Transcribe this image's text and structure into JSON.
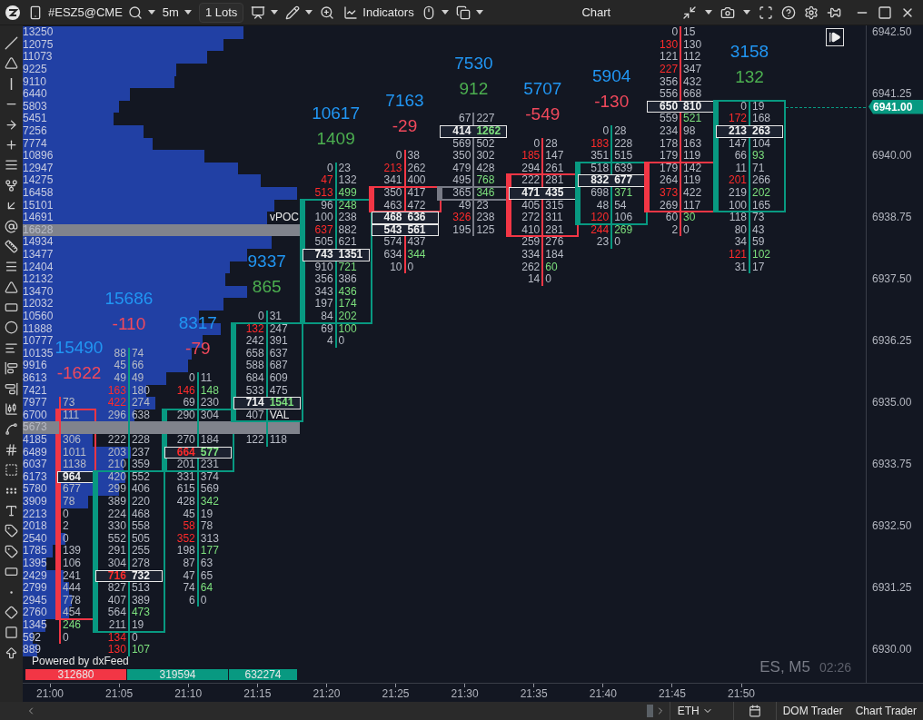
{
  "toolbar": {
    "symbol": "#ESZ5@CME",
    "timeframe": "5m",
    "lots": "1 Lots",
    "indicators": "Indicators",
    "title": "Chart"
  },
  "profile": [
    {
      "volume": "13250",
      "highlight": false
    },
    {
      "volume": "12075",
      "highlight": false
    },
    {
      "volume": "11073",
      "highlight": false
    },
    {
      "volume": "9225",
      "highlight": false
    },
    {
      "volume": "9110",
      "highlight": false
    },
    {
      "volume": "6440",
      "highlight": false
    },
    {
      "volume": "5803",
      "highlight": false
    },
    {
      "volume": "5451",
      "highlight": false
    },
    {
      "volume": "7256",
      "highlight": false
    },
    {
      "volume": "7774",
      "highlight": false
    },
    {
      "volume": "10896",
      "highlight": false
    },
    {
      "volume": "12947",
      "highlight": false
    },
    {
      "volume": "14275",
      "highlight": false
    },
    {
      "volume": "16458",
      "highlight": false
    },
    {
      "volume": "15101",
      "highlight": false
    },
    {
      "volume": "14691",
      "highlight": false
    },
    {
      "volume": "16628",
      "highlight": true
    },
    {
      "volume": "14934",
      "highlight": false
    },
    {
      "volume": "13477",
      "highlight": false
    },
    {
      "volume": "12404",
      "highlight": false
    },
    {
      "volume": "12132",
      "highlight": false
    },
    {
      "volume": "13470",
      "highlight": false
    },
    {
      "volume": "12032",
      "highlight": false
    },
    {
      "volume": "10560",
      "highlight": false
    },
    {
      "volume": "11888",
      "highlight": false
    },
    {
      "volume": "10777",
      "highlight": false
    },
    {
      "volume": "10135",
      "highlight": false
    },
    {
      "volume": "9916",
      "highlight": false
    },
    {
      "volume": "8613",
      "highlight": false
    },
    {
      "volume": "7421",
      "highlight": false
    },
    {
      "volume": "7977",
      "highlight": false
    },
    {
      "volume": "6700",
      "highlight": false
    },
    {
      "volume": "5673",
      "highlight": true
    },
    {
      "volume": "4185",
      "highlight": false
    },
    {
      "volume": "6489",
      "highlight": false
    },
    {
      "volume": "6037",
      "highlight": false
    },
    {
      "volume": "6173",
      "highlight": false
    },
    {
      "volume": "5780",
      "highlight": false
    },
    {
      "volume": "3909",
      "highlight": false
    },
    {
      "volume": "2213",
      "highlight": false
    },
    {
      "volume": "2018",
      "highlight": false
    },
    {
      "volume": "2540",
      "highlight": false
    },
    {
      "volume": "1785",
      "highlight": false
    },
    {
      "volume": "1395",
      "highlight": false
    },
    {
      "volume": "2429",
      "highlight": false
    },
    {
      "volume": "2799",
      "highlight": false
    },
    {
      "volume": "2945",
      "highlight": false
    },
    {
      "volume": "2760",
      "highlight": false
    },
    {
      "volume": "1345",
      "highlight": false
    },
    {
      "volume": "592",
      "highlight": false
    },
    {
      "volume": "889",
      "highlight": false
    }
  ],
  "vpoc_label": "vPOC",
  "candles": [
    {
      "volume": "15490",
      "delta": "-1622",
      "delta_negative": true,
      "kind": "down",
      "rows": [
        null,
        null,
        null,
        null,
        null,
        null,
        null,
        null,
        null,
        null,
        null,
        null,
        null,
        null,
        null,
        null,
        null,
        null,
        null,
        null,
        null,
        null,
        null,
        null,
        null,
        null,
        null,
        null,
        null,
        null,
        {
          "ask": "73",
          "ask_green": false,
          "body": false,
          "poc": false
        },
        {
          "ask": "111",
          "ask_green": false,
          "body": true,
          "poc": false
        },
        null,
        {
          "ask": "306",
          "ask_green": false,
          "body": true,
          "poc": false
        },
        {
          "ask": "1011",
          "ask_green": false,
          "body": true,
          "poc": false
        },
        {
          "ask": "1138",
          "ask_green": false,
          "body": true,
          "poc": false
        },
        {
          "ask": "964",
          "ask_green": false,
          "body": true,
          "poc": true
        },
        {
          "ask": "677",
          "ask_green": false,
          "body": true,
          "poc": false
        },
        {
          "ask": "78",
          "ask_green": false,
          "body": true,
          "poc": false
        },
        {
          "ask": "0",
          "ask_green": false,
          "body": true,
          "poc": false
        },
        {
          "ask": "2",
          "ask_green": false,
          "body": true,
          "poc": false
        },
        {
          "ask": "0",
          "ask_green": false,
          "body": true,
          "poc": false
        },
        {
          "ask": "139",
          "ask_green": false,
          "body": true,
          "poc": false
        },
        {
          "ask": "106",
          "ask_green": false,
          "body": true,
          "poc": false
        },
        {
          "ask": "241",
          "ask_green": false,
          "body": true,
          "poc": false
        },
        {
          "ask": "444",
          "ask_green": false,
          "body": true,
          "poc": false
        },
        {
          "ask": "778",
          "ask_green": false,
          "body": true,
          "poc": false
        },
        {
          "ask": "454",
          "ask_green": false,
          "body": true,
          "poc": false
        },
        {
          "ask": "246",
          "ask_green": true,
          "body": false,
          "poc": false
        },
        {
          "ask": "0",
          "ask_green": false,
          "body": false,
          "poc": false
        }
      ]
    },
    {
      "volume": "15686",
      "delta": "-110",
      "delta_negative": true,
      "kind": "up",
      "rows": [
        null,
        null,
        null,
        null,
        null,
        null,
        null,
        null,
        null,
        null,
        null,
        null,
        null,
        null,
        null,
        null,
        null,
        null,
        null,
        null,
        null,
        null,
        null,
        null,
        null,
        null,
        {
          "bid": "88",
          "ask": "74",
          "bid_red": false,
          "ask_green": false,
          "body": false,
          "poc": false
        },
        {
          "bid": "45",
          "ask": "66",
          "bid_red": false,
          "ask_green": false,
          "body": false,
          "poc": false
        },
        {
          "bid": "49",
          "ask": "49",
          "bid_red": false,
          "ask_green": false,
          "body": false,
          "poc": false
        },
        {
          "bid": "163",
          "ask": "180",
          "bid_red": true,
          "ask_green": false,
          "body": false,
          "poc": false
        },
        {
          "bid": "422",
          "ask": "274",
          "bid_red": true,
          "ask_green": false,
          "body": false,
          "poc": false
        },
        {
          "bid": "296",
          "ask": "638",
          "bid_red": false,
          "ask_green": false,
          "body": false,
          "poc": false
        },
        null,
        {
          "bid": "222",
          "ask": "228",
          "bid_red": false,
          "ask_green": false,
          "body": false,
          "poc": false
        },
        {
          "bid": "203",
          "ask": "237",
          "bid_red": false,
          "ask_green": false,
          "body": false,
          "poc": false
        },
        {
          "bid": "210",
          "ask": "359",
          "bid_red": false,
          "ask_green": false,
          "body": false,
          "poc": false
        },
        {
          "bid": "420",
          "ask": "552",
          "bid_red": false,
          "ask_green": false,
          "body": true,
          "poc": false
        },
        {
          "bid": "299",
          "ask": "406",
          "bid_red": false,
          "ask_green": false,
          "body": true,
          "poc": false
        },
        {
          "bid": "389",
          "ask": "220",
          "bid_red": false,
          "ask_green": false,
          "body": true,
          "poc": false
        },
        {
          "bid": "224",
          "ask": "468",
          "bid_red": false,
          "ask_green": false,
          "body": true,
          "poc": false
        },
        {
          "bid": "330",
          "ask": "558",
          "bid_red": false,
          "ask_green": false,
          "body": true,
          "poc": false
        },
        {
          "bid": "552",
          "ask": "505",
          "bid_red": false,
          "ask_green": false,
          "body": true,
          "poc": false
        },
        {
          "bid": "291",
          "ask": "255",
          "bid_red": false,
          "ask_green": false,
          "body": true,
          "poc": false
        },
        {
          "bid": "304",
          "ask": "278",
          "bid_red": false,
          "ask_green": false,
          "body": true,
          "poc": false
        },
        {
          "bid": "716",
          "ask": "732",
          "bid_red": true,
          "ask_green": false,
          "body": true,
          "poc": true
        },
        {
          "bid": "827",
          "ask": "513",
          "bid_red": false,
          "ask_green": false,
          "body": true,
          "poc": false
        },
        {
          "bid": "407",
          "ask": "389",
          "bid_red": false,
          "ask_green": false,
          "body": true,
          "poc": false
        },
        {
          "bid": "564",
          "ask": "473",
          "bid_red": false,
          "ask_green": true,
          "body": true,
          "poc": false
        },
        {
          "bid": "211",
          "ask": "19",
          "bid_red": false,
          "ask_green": false,
          "body": true,
          "poc": false
        },
        {
          "bid": "134",
          "ask": "0",
          "bid_red": true,
          "ask_green": false,
          "body": false,
          "poc": false
        },
        {
          "bid": "130",
          "ask": "107",
          "bid_red": true,
          "ask_green": true,
          "body": false,
          "poc": false
        }
      ]
    },
    {
      "volume": "8317",
      "delta": "-79",
      "delta_negative": true,
      "kind": "up",
      "rows": [
        null,
        null,
        null,
        null,
        null,
        null,
        null,
        null,
        null,
        null,
        null,
        null,
        null,
        null,
        null,
        null,
        null,
        null,
        null,
        null,
        null,
        null,
        null,
        null,
        null,
        null,
        null,
        null,
        {
          "bid": "0",
          "ask": "11",
          "bid_red": false,
          "ask_green": false,
          "body": false,
          "poc": false
        },
        {
          "bid": "146",
          "ask": "148",
          "bid_red": true,
          "ask_green": true,
          "body": false,
          "poc": false
        },
        {
          "bid": "69",
          "ask": "230",
          "bid_red": false,
          "ask_green": false,
          "body": false,
          "poc": false
        },
        {
          "bid": "290",
          "ask": "304",
          "bid_red": false,
          "ask_green": false,
          "body": true,
          "poc": false
        },
        null,
        {
          "bid": "270",
          "ask": "184",
          "bid_red": false,
          "ask_green": false,
          "body": true,
          "poc": false
        },
        {
          "bid": "664",
          "ask": "577",
          "bid_red": true,
          "ask_green": true,
          "body": true,
          "poc": true
        },
        {
          "bid": "201",
          "ask": "231",
          "bid_red": false,
          "ask_green": false,
          "body": true,
          "poc": false
        },
        {
          "bid": "331",
          "ask": "374",
          "bid_red": false,
          "ask_green": false,
          "body": false,
          "poc": false
        },
        {
          "bid": "615",
          "ask": "569",
          "bid_red": false,
          "ask_green": false,
          "body": false,
          "poc": false
        },
        {
          "bid": "428",
          "ask": "342",
          "bid_red": false,
          "ask_green": true,
          "body": false,
          "poc": false
        },
        {
          "bid": "45",
          "ask": "19",
          "bid_red": false,
          "ask_green": false,
          "body": false,
          "poc": false
        },
        {
          "bid": "58",
          "ask": "78",
          "bid_red": true,
          "ask_green": false,
          "body": false,
          "poc": false
        },
        {
          "bid": "352",
          "ask": "313",
          "bid_red": true,
          "ask_green": false,
          "body": false,
          "poc": false
        },
        {
          "bid": "198",
          "ask": "177",
          "bid_red": false,
          "ask_green": true,
          "body": false,
          "poc": false
        },
        {
          "bid": "87",
          "ask": "63",
          "bid_red": false,
          "ask_green": false,
          "body": false,
          "poc": false
        },
        {
          "bid": "47",
          "ask": "65",
          "bid_red": false,
          "ask_green": false,
          "body": false,
          "poc": false
        },
        {
          "bid": "74",
          "ask": "64",
          "bid_red": false,
          "ask_green": true,
          "body": false,
          "poc": false
        },
        {
          "bid": "6",
          "ask": "0",
          "bid_red": false,
          "ask_green": false,
          "body": false,
          "poc": false
        }
      ]
    },
    {
      "volume": "9337",
      "delta": "865",
      "delta_negative": false,
      "kind": "up",
      "rows": [
        null,
        null,
        null,
        null,
        null,
        null,
        null,
        null,
        null,
        null,
        null,
        null,
        null,
        null,
        null,
        null,
        null,
        null,
        null,
        null,
        null,
        null,
        null,
        {
          "bid": "0",
          "ask": "31",
          "bid_red": false,
          "ask_green": false,
          "body": false,
          "poc": false
        },
        {
          "bid": "132",
          "ask": "247",
          "bid_red": true,
          "ask_green": false,
          "body": true,
          "poc": false
        },
        {
          "bid": "242",
          "ask": "391",
          "bid_red": false,
          "ask_green": false,
          "body": true,
          "poc": false
        },
        {
          "bid": "658",
          "ask": "637",
          "bid_red": false,
          "ask_green": false,
          "body": true,
          "poc": false
        },
        {
          "bid": "588",
          "ask": "687",
          "bid_red": false,
          "ask_green": false,
          "body": true,
          "poc": false
        },
        {
          "bid": "684",
          "ask": "609",
          "bid_red": false,
          "ask_green": false,
          "body": true,
          "poc": false
        },
        {
          "bid": "533",
          "ask": "475",
          "bid_red": false,
          "ask_green": false,
          "body": true,
          "poc": false
        },
        {
          "bid": "714",
          "ask": "1541",
          "bid_red": false,
          "ask_green": true,
          "body": true,
          "poc": true
        },
        {
          "bid": "407",
          "bid_red": false,
          "label": "VAL",
          "body": true,
          "poc": false
        },
        null,
        {
          "bid": "122",
          "ask": "118",
          "bid_red": false,
          "ask_green": false,
          "body": false,
          "poc": false
        }
      ]
    },
    {
      "volume": "10617",
      "delta": "1409",
      "delta_negative": false,
      "kind": "up",
      "rows": [
        null,
        null,
        null,
        null,
        null,
        null,
        null,
        null,
        null,
        null,
        null,
        {
          "bid": "0",
          "ask": "23",
          "bid_red": false,
          "ask_green": false,
          "body": false,
          "poc": false
        },
        {
          "bid": "47",
          "ask": "132",
          "bid_red": true,
          "ask_green": false,
          "body": false,
          "poc": false
        },
        {
          "bid": "513",
          "ask": "499",
          "bid_red": true,
          "ask_green": true,
          "body": false,
          "poc": false
        },
        {
          "bid": "96",
          "ask": "248",
          "bid_red": false,
          "ask_green": true,
          "body": true,
          "poc": false
        },
        {
          "bid": "100",
          "ask": "238",
          "bid_red": false,
          "ask_green": false,
          "body": true,
          "poc": false
        },
        {
          "bid": "637",
          "ask": "882",
          "bid_red": true,
          "ask_green": false,
          "body": true,
          "poc": false
        },
        {
          "bid": "505",
          "ask": "621",
          "bid_red": false,
          "ask_green": false,
          "body": true,
          "poc": false
        },
        {
          "bid": "743",
          "ask": "1351",
          "bid_red": false,
          "ask_green": false,
          "body": true,
          "poc": true
        },
        {
          "bid": "910",
          "ask": "721",
          "bid_red": false,
          "ask_green": true,
          "body": true,
          "poc": false
        },
        {
          "bid": "356",
          "ask": "386",
          "bid_red": false,
          "ask_green": false,
          "body": true,
          "poc": false
        },
        {
          "bid": "343",
          "ask": "436",
          "bid_red": false,
          "ask_green": true,
          "body": true,
          "poc": false
        },
        {
          "bid": "197",
          "ask": "174",
          "bid_red": false,
          "ask_green": true,
          "body": true,
          "poc": false
        },
        {
          "bid": "84",
          "ask": "202",
          "bid_red": false,
          "ask_green": true,
          "body": true,
          "poc": false
        },
        {
          "bid": "69",
          "ask": "100",
          "bid_red": false,
          "ask_green": true,
          "body": false,
          "poc": false
        },
        {
          "bid": "4",
          "ask": "0",
          "bid_red": false,
          "ask_green": false,
          "body": false,
          "poc": false
        }
      ]
    },
    {
      "volume": "7163",
      "delta": "-29",
      "delta_negative": true,
      "kind": "down",
      "rows": [
        null,
        null,
        null,
        null,
        null,
        null,
        null,
        null,
        null,
        null,
        {
          "bid": "0",
          "ask": "38",
          "bid_red": false,
          "ask_green": false,
          "body": false,
          "poc": false
        },
        {
          "bid": "213",
          "ask": "262",
          "bid_red": true,
          "ask_green": false,
          "body": false,
          "poc": false
        },
        {
          "bid": "341",
          "ask": "400",
          "bid_red": false,
          "ask_green": false,
          "body": false,
          "poc": false
        },
        {
          "bid": "350",
          "ask": "417",
          "bid_red": false,
          "ask_green": false,
          "body": true,
          "poc": false
        },
        {
          "bid": "463",
          "ask": "472",
          "bid_red": false,
          "ask_green": false,
          "body": true,
          "poc": false
        },
        {
          "bid": "468",
          "ask": "636",
          "bid_red": false,
          "ask_green": false,
          "body": false,
          "poc": true
        },
        {
          "bid": "543",
          "ask": "561",
          "bid_red": false,
          "ask_green": false,
          "body": false,
          "poc": true
        },
        {
          "bid": "574",
          "ask": "437",
          "bid_red": false,
          "ask_green": false,
          "body": false,
          "poc": false
        },
        {
          "bid": "634",
          "ask": "344",
          "bid_red": false,
          "ask_green": true,
          "body": false,
          "poc": false
        },
        {
          "bid": "10",
          "ask": "0",
          "bid_red": false,
          "ask_green": false,
          "body": false,
          "poc": false
        }
      ]
    },
    {
      "volume": "7530",
      "delta": "912",
      "delta_negative": false,
      "kind": "flat",
      "rows": [
        null,
        null,
        null,
        null,
        null,
        null,
        null,
        {
          "bid": "67",
          "ask": "227",
          "bid_red": false,
          "ask_green": false,
          "body": false,
          "poc": false
        },
        {
          "bid": "414",
          "ask": "1262",
          "bid_red": false,
          "ask_green": true,
          "body": false,
          "poc": true
        },
        {
          "bid": "569",
          "ask": "502",
          "bid_red": false,
          "ask_green": false,
          "body": false,
          "poc": false
        },
        {
          "bid": "350",
          "ask": "302",
          "bid_red": false,
          "ask_green": false,
          "body": false,
          "poc": false
        },
        {
          "bid": "479",
          "ask": "428",
          "bid_red": false,
          "ask_green": false,
          "body": false,
          "poc": false
        },
        {
          "bid": "495",
          "ask": "768",
          "bid_red": false,
          "ask_green": true,
          "body": false,
          "poc": false
        },
        {
          "bid": "365",
          "ask": "346",
          "bid_red": false,
          "ask_green": true,
          "body": true,
          "poc": false
        },
        {
          "bid": "49",
          "ask": "23",
          "bid_red": false,
          "ask_green": false,
          "body": false,
          "poc": false
        },
        {
          "bid": "326",
          "ask": "238",
          "bid_red": true,
          "ask_green": false,
          "body": false,
          "poc": false
        },
        {
          "bid": "195",
          "ask": "125",
          "bid_red": false,
          "ask_green": false,
          "body": false,
          "poc": false
        }
      ]
    },
    {
      "volume": "5707",
      "delta": "-549",
      "delta_negative": true,
      "kind": "down",
      "rows": [
        null,
        null,
        null,
        null,
        null,
        null,
        null,
        null,
        null,
        {
          "bid": "0",
          "ask": "28",
          "bid_red": false,
          "ask_green": false,
          "body": false,
          "poc": false
        },
        {
          "bid": "185",
          "ask": "147",
          "bid_red": true,
          "ask_green": false,
          "body": false,
          "poc": false
        },
        {
          "bid": "294",
          "ask": "261",
          "bid_red": false,
          "ask_green": false,
          "body": false,
          "poc": false
        },
        {
          "bid": "222",
          "ask": "281",
          "bid_red": false,
          "ask_green": false,
          "body": true,
          "poc": false
        },
        {
          "bid": "471",
          "ask": "435",
          "bid_red": false,
          "ask_green": false,
          "body": true,
          "poc": true
        },
        {
          "bid": "405",
          "ask": "315",
          "bid_red": false,
          "ask_green": false,
          "body": true,
          "poc": false
        },
        {
          "bid": "272",
          "ask": "311",
          "bid_red": false,
          "ask_green": false,
          "body": true,
          "poc": false
        },
        {
          "bid": "410",
          "ask": "281",
          "bid_red": false,
          "ask_green": false,
          "body": true,
          "poc": false
        },
        {
          "bid": "259",
          "ask": "276",
          "bid_red": false,
          "ask_green": false,
          "body": false,
          "poc": false
        },
        {
          "bid": "334",
          "ask": "184",
          "bid_red": false,
          "ask_green": false,
          "body": false,
          "poc": false
        },
        {
          "bid": "262",
          "ask": "60",
          "bid_red": false,
          "ask_green": true,
          "body": false,
          "poc": false
        },
        {
          "bid": "14",
          "ask": "0",
          "bid_red": false,
          "ask_green": false,
          "body": false,
          "poc": false
        }
      ]
    },
    {
      "volume": "5904",
      "delta": "-130",
      "delta_negative": true,
      "kind": "up",
      "rows": [
        null,
        null,
        null,
        null,
        null,
        null,
        null,
        null,
        {
          "bid": "0",
          "ask": "28",
          "bid_red": false,
          "ask_green": false,
          "body": false,
          "poc": false
        },
        {
          "bid": "183",
          "ask": "228",
          "bid_red": true,
          "ask_green": false,
          "body": false,
          "poc": false
        },
        {
          "bid": "351",
          "ask": "515",
          "bid_red": false,
          "ask_green": false,
          "body": false,
          "poc": false
        },
        {
          "bid": "518",
          "ask": "639",
          "bid_red": false,
          "ask_green": false,
          "body": true,
          "poc": false
        },
        {
          "bid": "832",
          "ask": "677",
          "bid_red": false,
          "ask_green": false,
          "body": true,
          "poc": true
        },
        {
          "bid": "698",
          "ask": "371",
          "bid_red": false,
          "ask_green": true,
          "body": true,
          "poc": false
        },
        {
          "bid": "48",
          "ask": "54",
          "bid_red": false,
          "ask_green": false,
          "body": true,
          "poc": false
        },
        {
          "bid": "120",
          "ask": "106",
          "bid_red": true,
          "ask_green": false,
          "body": true,
          "poc": false
        },
        {
          "bid": "244",
          "ask": "269",
          "bid_red": true,
          "ask_green": true,
          "body": false,
          "poc": false
        },
        {
          "bid": "23",
          "ask": "0",
          "bid_red": false,
          "ask_green": false,
          "body": false,
          "poc": false
        }
      ]
    },
    {
      "kind": "down",
      "rows": [
        {
          "bid": "0",
          "ask": "15",
          "bid_red": false,
          "ask_green": false,
          "body": false,
          "poc": false
        },
        {
          "bid": "130",
          "ask": "130",
          "bid_red": true,
          "ask_green": false,
          "body": false,
          "poc": false
        },
        {
          "bid": "121",
          "ask": "112",
          "bid_red": false,
          "ask_green": false,
          "body": false,
          "poc": false
        },
        {
          "bid": "227",
          "ask": "347",
          "bid_red": true,
          "ask_green": false,
          "body": false,
          "poc": false
        },
        {
          "bid": "356",
          "ask": "432",
          "bid_red": false,
          "ask_green": false,
          "body": false,
          "poc": false
        },
        {
          "bid": "556",
          "ask": "668",
          "bid_red": false,
          "ask_green": false,
          "body": false,
          "poc": false
        },
        {
          "bid": "650",
          "ask": "810",
          "bid_red": false,
          "ask_green": false,
          "body": false,
          "poc": true
        },
        {
          "bid": "559",
          "ask": "521",
          "bid_red": false,
          "ask_green": true,
          "body": false,
          "poc": false
        },
        {
          "bid": "234",
          "ask": "98",
          "bid_red": false,
          "ask_green": false,
          "body": false,
          "poc": false
        },
        {
          "bid": "178",
          "ask": "163",
          "bid_red": false,
          "ask_green": false,
          "body": false,
          "poc": false
        },
        {
          "bid": "179",
          "ask": "119",
          "bid_red": false,
          "ask_green": false,
          "body": false,
          "poc": false
        },
        {
          "bid": "179",
          "ask": "142",
          "bid_red": false,
          "ask_green": false,
          "body": true,
          "poc": false
        },
        {
          "bid": "264",
          "ask": "119",
          "bid_red": false,
          "ask_green": false,
          "body": true,
          "poc": false
        },
        {
          "bid": "373",
          "ask": "422",
          "bid_red": true,
          "ask_green": false,
          "body": true,
          "poc": false
        },
        {
          "bid": "269",
          "ask": "117",
          "bid_red": false,
          "ask_green": false,
          "body": true,
          "poc": false
        },
        {
          "bid": "60",
          "ask": "30",
          "bid_red": false,
          "ask_green": true,
          "body": false,
          "poc": false
        },
        {
          "bid": "2",
          "ask": "0",
          "bid_red": false,
          "ask_green": false,
          "body": false,
          "poc": false
        }
      ]
    },
    {
      "volume": "3158",
      "delta": "132",
      "delta_negative": false,
      "kind": "up",
      "rows": [
        null,
        null,
        null,
        null,
        null,
        null,
        {
          "bid": "0",
          "ask": "19",
          "bid_red": false,
          "ask_green": false,
          "body": true,
          "poc": false
        },
        {
          "bid": "172",
          "ask": "168",
          "bid_red": true,
          "ask_green": false,
          "body": true,
          "poc": false
        },
        {
          "bid": "213",
          "ask": "263",
          "bid_red": false,
          "ask_green": false,
          "body": true,
          "poc": true
        },
        {
          "bid": "147",
          "ask": "104",
          "bid_red": false,
          "ask_green": false,
          "body": true,
          "poc": false
        },
        {
          "bid": "66",
          "ask": "93",
          "bid_red": false,
          "ask_green": true,
          "body": true,
          "poc": false
        },
        {
          "bid": "11",
          "ask": "71",
          "bid_red": false,
          "ask_green": false,
          "body": true,
          "poc": false
        },
        {
          "bid": "201",
          "ask": "266",
          "bid_red": true,
          "ask_green": false,
          "body": true,
          "poc": false
        },
        {
          "bid": "219",
          "ask": "202",
          "bid_red": false,
          "ask_green": true,
          "body": true,
          "poc": false
        },
        {
          "bid": "100",
          "ask": "165",
          "bid_red": false,
          "ask_green": false,
          "body": true,
          "poc": false
        },
        {
          "bid": "118",
          "ask": "73",
          "bid_red": false,
          "ask_green": false,
          "body": false,
          "poc": false
        },
        {
          "bid": "80",
          "ask": "43",
          "bid_red": false,
          "ask_green": false,
          "body": false,
          "poc": false
        },
        {
          "bid": "34",
          "ask": "59",
          "bid_red": false,
          "ask_green": false,
          "body": false,
          "poc": false
        },
        {
          "bid": "121",
          "ask": "102",
          "bid_red": true,
          "ask_green": true,
          "body": false,
          "poc": false
        },
        {
          "bid": "31",
          "ask": "17",
          "bid_red": false,
          "ask_green": false,
          "body": false,
          "poc": false
        }
      ]
    }
  ],
  "totals": [
    {
      "value": "312680",
      "color": "#f23645"
    },
    {
      "value": "319594",
      "color": "#089981"
    },
    {
      "value": "632274",
      "color": "#089981"
    }
  ],
  "provider_note": "Powered by dxFeed",
  "legend": {
    "symbol": "ES, M5",
    "countdown": "02:26"
  },
  "price_axis": [
    "6942.50",
    "6941.25",
    "6940.00",
    "6938.75",
    "6937.50",
    "6936.25",
    "6935.00",
    "6933.75",
    "6932.50",
    "6931.25",
    "6930.00"
  ],
  "current_price": "6941.00",
  "time_axis": [
    "21:00",
    "21:05",
    "21:10",
    "21:15",
    "21:20",
    "21:25",
    "21:30",
    "21:35",
    "21:40",
    "21:45",
    "21:50"
  ],
  "footer": {
    "session": "ETH",
    "buttons": [
      "DOM Trader",
      "Chart Trader"
    ]
  }
}
